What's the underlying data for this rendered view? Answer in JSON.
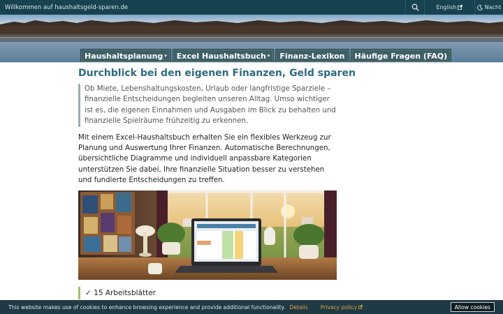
{
  "topbar": {
    "welcome": "Willkommen auf haushaltsgeld-sparen.de",
    "lang_label": "English",
    "night_label": "Nacht"
  },
  "nav": {
    "items": [
      {
        "label": "Haushaltsplanung",
        "caret": "▾"
      },
      {
        "label": "Excel Haushaltsbuch",
        "caret": "▾"
      },
      {
        "label": "Finanz-Lexikon",
        "caret": ""
      },
      {
        "label": "Häufige Fragen (FAQ)",
        "caret": ""
      }
    ]
  },
  "main": {
    "title": "Durchblick bei den eigenen Finanzen, Geld sparen",
    "quote": "Ob Miete, Lebenshaltungskosten, Urlaub oder langfristige Sparziele – finanzielle Entscheidungen begleiten unseren Alltag. Umso wichtiger ist es, die eigenen Einnahmen und Ausgaben im Blick zu behalten und finanzielle Spielräume frühzeitig zu erkennen.",
    "intro": "Mit einem Excel-Haushaltsbuch erhalten Sie ein flexibles Werkzeug zur Planung und Auswertung Ihrer Finanzen. Automatische Berechnungen, übersichtliche Diagramme und individuell anpassbare Kategorien unterstützen Sie dabei, Ihre finanzielle Situation besser zu verstehen und fundierte Entscheidungen zu treffen.",
    "checklist_first": "✓ 15 Arbeitsblätter"
  },
  "cookie": {
    "message": "This website makes use of cookies to enhance browsing experience and provide additional functionality.",
    "details": "Details",
    "privacy": "Privacy policy",
    "allow": "Allow cookies"
  },
  "colors": {
    "topbar": "#17424f",
    "nav_tab": "#3f5f66",
    "title": "#2d6b80",
    "cookie_link": "#e0a640"
  }
}
